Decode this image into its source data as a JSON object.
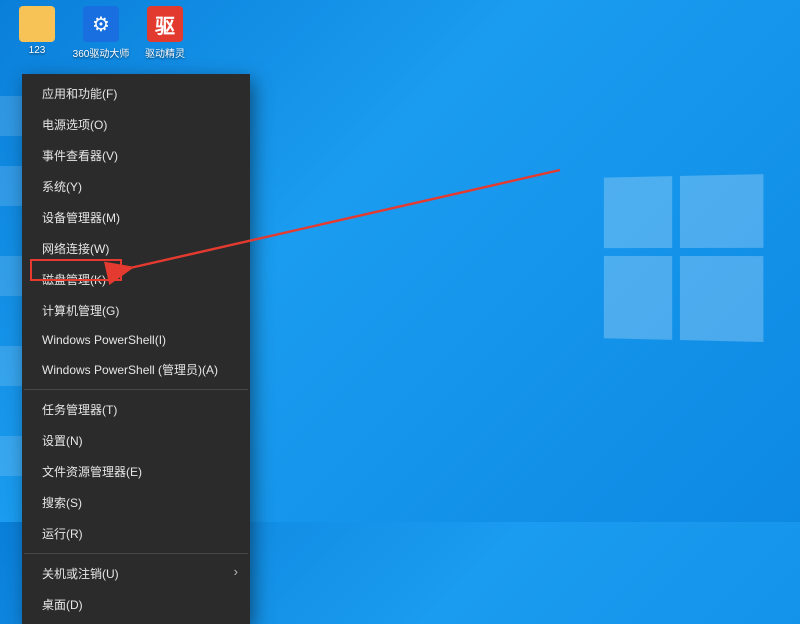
{
  "desktop": {
    "icons": [
      {
        "name": "folder-123",
        "label": "123",
        "iconClass": "ico-folder",
        "glyph": ""
      },
      {
        "name": "360-driver",
        "label": "360驱动大师",
        "iconClass": "ico-blue",
        "glyph": "⚙"
      },
      {
        "name": "driver-genius",
        "label": "驱动精灵",
        "iconClass": "ico-red",
        "glyph": "驱"
      }
    ]
  },
  "contextMenu": {
    "groups": [
      [
        {
          "label": "应用和功能(F)",
          "arrow": false
        },
        {
          "label": "电源选项(O)",
          "arrow": false
        },
        {
          "label": "事件查看器(V)",
          "arrow": false
        },
        {
          "label": "系统(Y)",
          "arrow": false
        },
        {
          "label": "设备管理器(M)",
          "arrow": false
        },
        {
          "label": "网络连接(W)",
          "arrow": false
        },
        {
          "label": "磁盘管理(K)",
          "arrow": false
        },
        {
          "label": "计算机管理(G)",
          "arrow": false,
          "highlighted": true
        },
        {
          "label": "Windows PowerShell(I)",
          "arrow": false
        },
        {
          "label": "Windows PowerShell (管理员)(A)",
          "arrow": false
        }
      ],
      [
        {
          "label": "任务管理器(T)",
          "arrow": false
        },
        {
          "label": "设置(N)",
          "arrow": false
        },
        {
          "label": "文件资源管理器(E)",
          "arrow": false
        },
        {
          "label": "搜索(S)",
          "arrow": false
        },
        {
          "label": "运行(R)",
          "arrow": false
        }
      ],
      [
        {
          "label": "关机或注销(U)",
          "arrow": true
        },
        {
          "label": "桌面(D)",
          "arrow": false
        }
      ]
    ]
  },
  "annotation": {
    "highlightTarget": "计算机管理(G)",
    "color": "#e53a2f"
  }
}
